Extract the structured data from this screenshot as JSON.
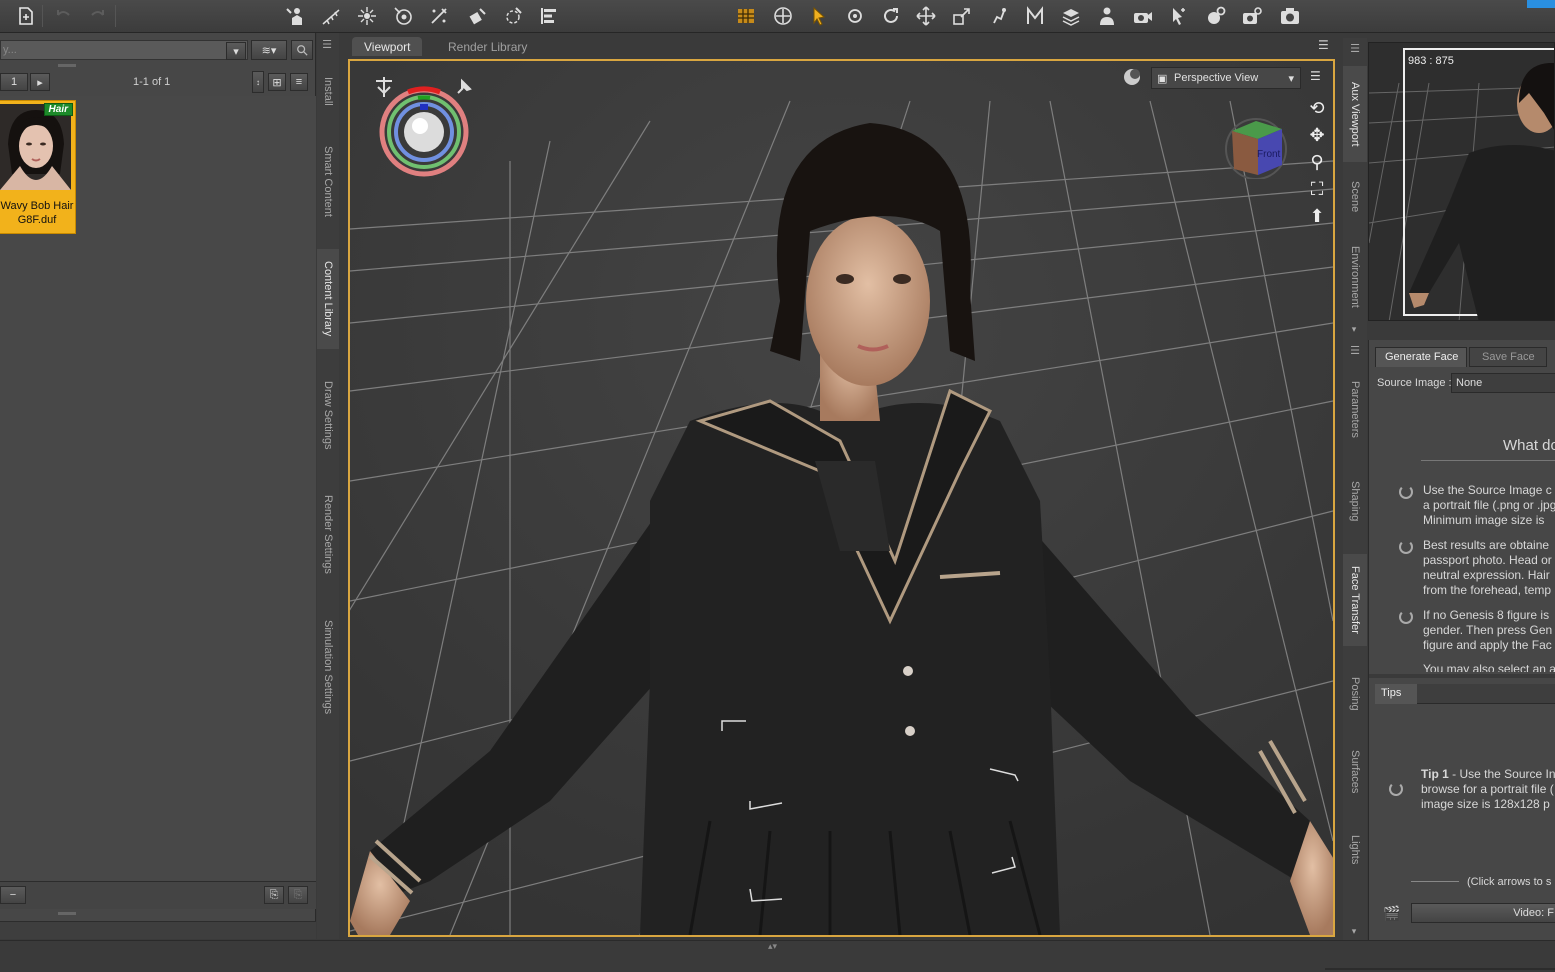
{
  "toolbar": {
    "icons": [
      "new-file-icon",
      "undo-icon",
      "redo-icon",
      "figure-setup-icon",
      "node-weight-icon",
      "joint-editor-icon",
      "geometry-sculptor-icon",
      "geometry-editor-icon",
      "edge-loop-icon",
      "smoothing-icon",
      "alignment-icon",
      "grid-toggle-icon",
      "universal-tool-icon",
      "node-selection-icon",
      "rotate-icon",
      "rotate-alt-icon",
      "translate-icon",
      "scale-icon",
      "active-pose-icon",
      "morph-icon",
      "region-nav-icon",
      "figure-select-icon",
      "camera-icon",
      "spot-render-icon",
      "render-settings-icon",
      "render-icon",
      "screenshot-icon"
    ]
  },
  "left_pane": {
    "search_placeholder": "y...",
    "page_number": "1",
    "page_count": "1-1 of 1",
    "item": {
      "badge": "Hair",
      "label": "Wavy Bob Hair G8F.duf"
    },
    "minus_label": "−"
  },
  "side_tabs_left": [
    "Install",
    "Smart Content",
    "Content Library",
    "Draw Settings",
    "Render Settings",
    "Simulation Settings"
  ],
  "viewport_tabs": [
    "Viewport",
    "Render Library"
  ],
  "viewport": {
    "view_mode": "Perspective View",
    "cube_label": "Front"
  },
  "aux_viewport": {
    "readout": "983 : 875"
  },
  "side_tabs_right_top": [
    "Aux Viewport",
    "Scene",
    "Environment"
  ],
  "side_tabs_right": [
    "Parameters",
    "Shaping",
    "Face Transfer",
    "Posing",
    "Surfaces",
    "Lights"
  ],
  "face_transfer": {
    "tabs": [
      "Generate Face",
      "Save Face"
    ],
    "source_label": "Source Image :",
    "source_value": "None",
    "heading": "What do",
    "bullets": [
      [
        "Use the Source Image c",
        "a portrait file (.png or .jpg",
        "Minimum image size is"
      ],
      [
        "Best results are obtaine",
        "passport photo. Head or",
        "neutral expression. Hair",
        "from the forehead, temp"
      ],
      [
        "If no Genesis 8 figure is",
        "gender. Then press Gen",
        "figure and apply the Fac"
      ],
      [
        "You may also select an a"
      ]
    ]
  },
  "tips": {
    "tab": "Tips",
    "tip_bold": "Tip 1",
    "tip_lines": [
      " - Use the Source In",
      "browse for a portrait file (",
      "image size is 128x128 p"
    ],
    "nav_text": "(Click arrows to s",
    "video_label": "Video: F"
  }
}
